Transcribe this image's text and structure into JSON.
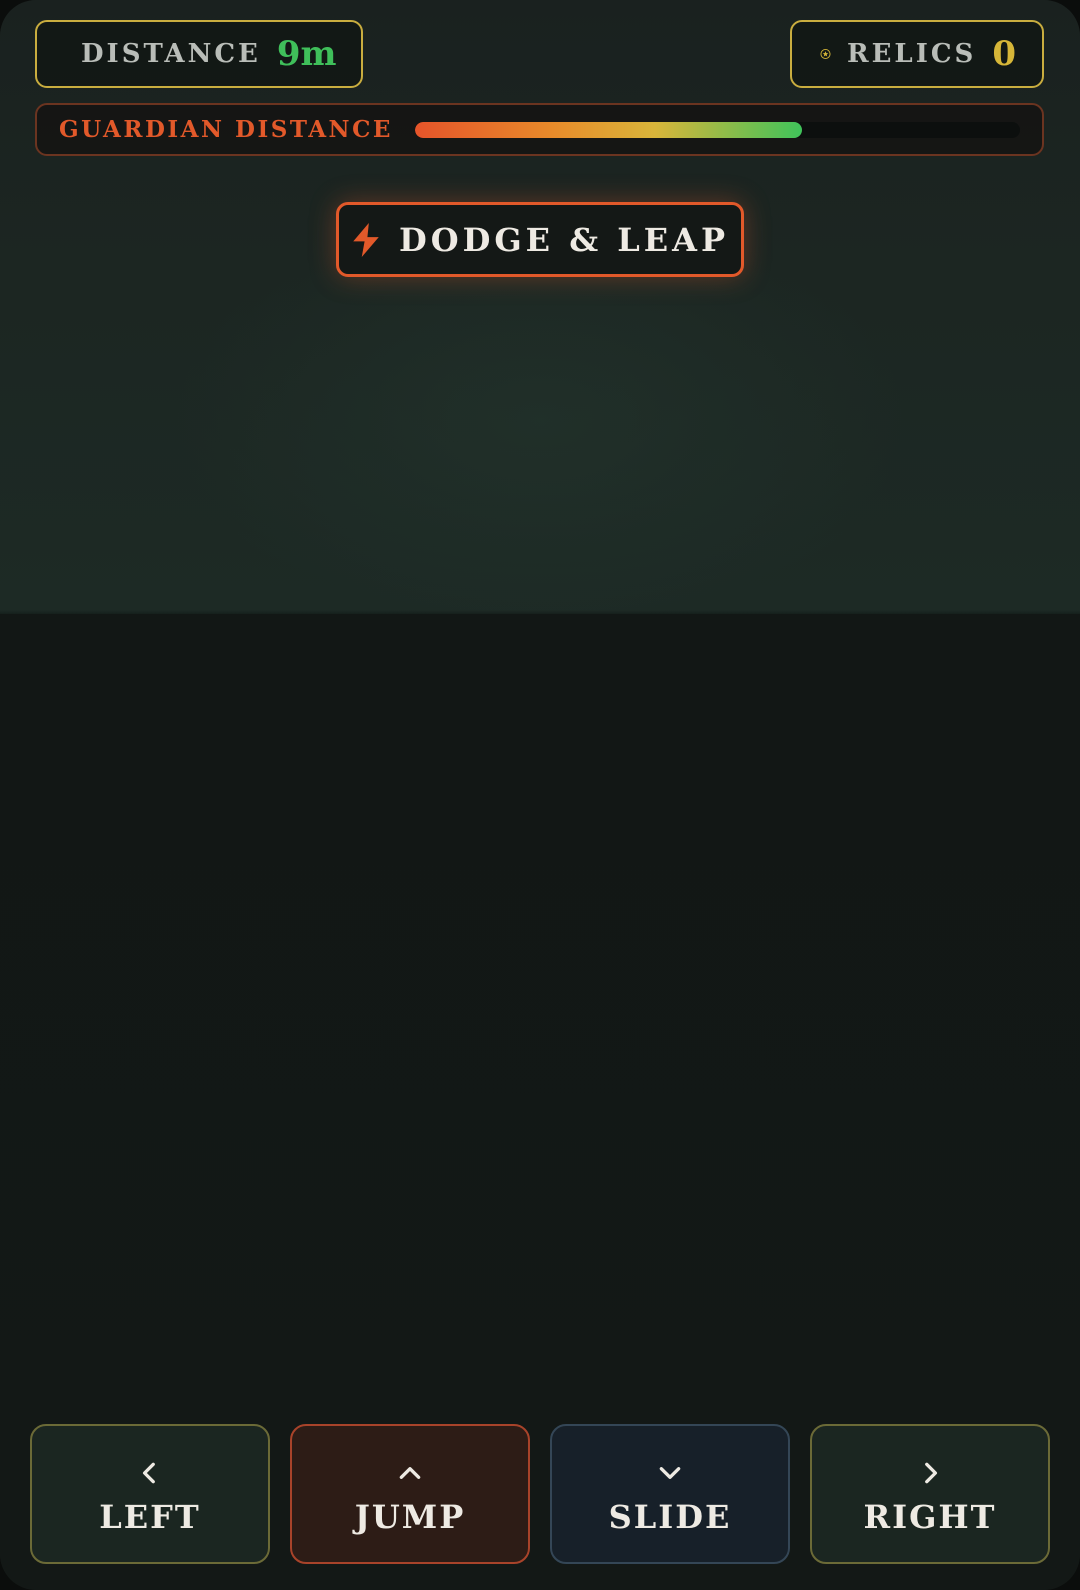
{
  "hud": {
    "distance": {
      "icon": "bolt-icon",
      "label": "DISTANCE",
      "value": "9m",
      "color": "#3fbf5a"
    },
    "relics": {
      "icon": "relic-icon",
      "label": "RELICS",
      "value": "0",
      "color": "#d6b638"
    }
  },
  "guardian": {
    "label": "GUARDIAN DISTANCE",
    "level": 0.64
  },
  "mode": {
    "icon": "bolt-icon",
    "label": "DODGE & LEAP",
    "color": "#e2592a"
  },
  "controls": [
    {
      "label": "LEFT",
      "icon": "chevron-left-icon"
    },
    {
      "label": "JUMP",
      "icon": "chevron-up-icon"
    },
    {
      "label": "SLIDE",
      "icon": "chevron-down-icon"
    },
    {
      "label": "RIGHT",
      "icon": "chevron-right-icon"
    }
  ]
}
